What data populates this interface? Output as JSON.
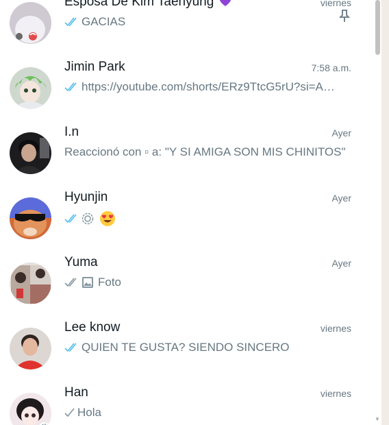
{
  "chats": [
    {
      "name": "Esposa De Kim Taehyung",
      "time": "viernes",
      "preview": "GACIAS",
      "ticks": "read",
      "pinned": true,
      "heart_emoji": "purple-heart"
    },
    {
      "name": "Jimin Park",
      "time": "7:58 a.m.",
      "preview": "https://youtube.com/shorts/ERz9TtcG5rU?si=A…",
      "ticks": "read"
    },
    {
      "name": "I.n",
      "time": "Ayer",
      "preview": "Reaccionó con ▫ a: \"Y SI AMIGA SON MIS CHINITOS\"",
      "ticks": "none"
    },
    {
      "name": "Hyunjin",
      "time": "Ayer",
      "preview": "",
      "ticks": "read",
      "preview_icons": [
        "status-ring-icon",
        "heart-eyes-emoji"
      ]
    },
    {
      "name": "Yuma",
      "time": "Ayer",
      "preview": "Foto",
      "ticks": "delivered",
      "preview_icons": [
        "photo-icon"
      ]
    },
    {
      "name": "Lee know",
      "time": "viernes",
      "preview": "QUIEN TE GUSTA? SIENDO SINCERO",
      "ticks": "read"
    },
    {
      "name": "Han",
      "time": "viernes",
      "preview": "Hola",
      "ticks": "sent"
    }
  ],
  "colors": {
    "read_tick": "#53bdeb",
    "delivered_tick": "#8696a0",
    "name": "#111b21",
    "meta": "#667781"
  }
}
